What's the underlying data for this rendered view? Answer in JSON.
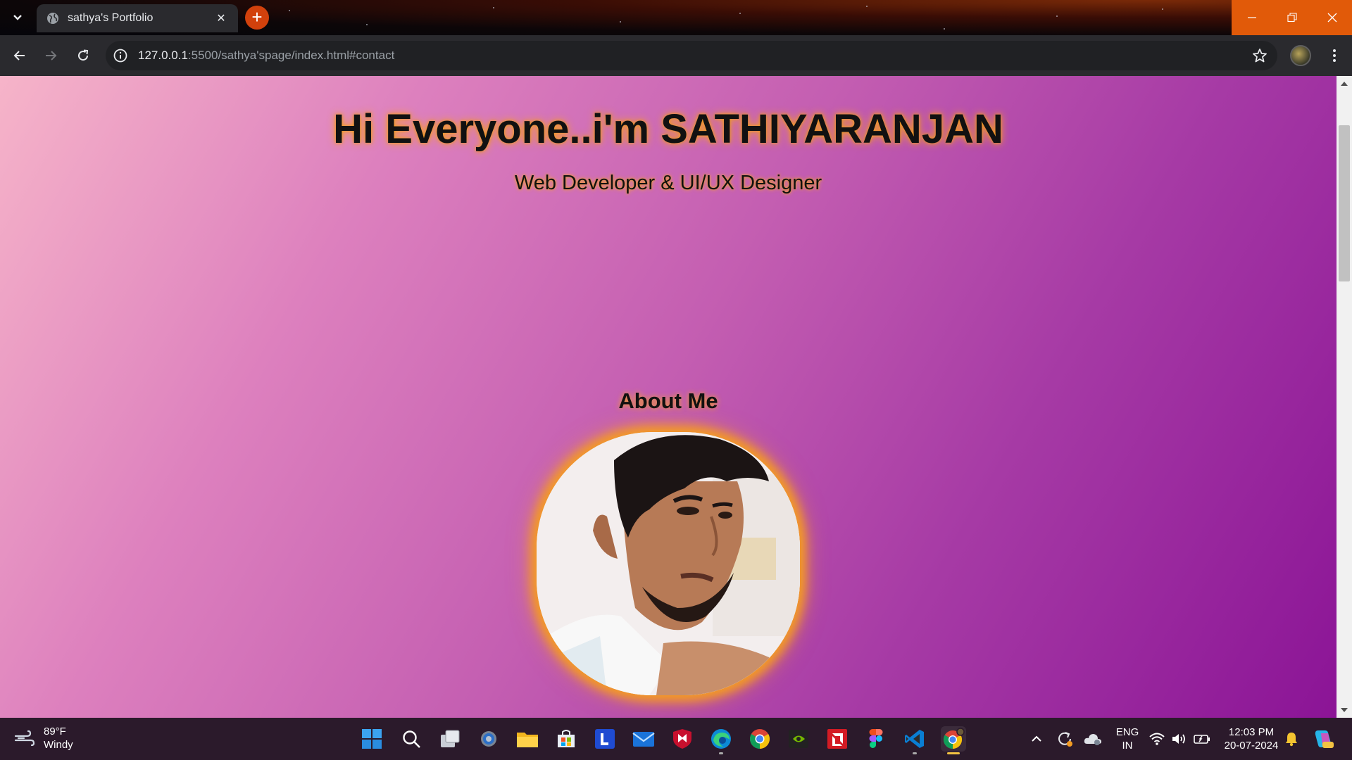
{
  "browser": {
    "tab_title": "sathya's Portfolio",
    "url_host": "127.0.0.1",
    "url_path": ":5500/sathya'spage/index.html#contact"
  },
  "page": {
    "hero_title": "Hi Everyone..i'm SATHIYARANJAN",
    "hero_subtitle": "Web Developer & UI/UX Designer",
    "about_heading": "About Me"
  },
  "taskbar": {
    "weather_temp": "89°F",
    "weather_desc": "Windy",
    "lang_line1": "ENG",
    "lang_line2": "IN",
    "time": "12:03 PM",
    "date": "20-07-2024",
    "apps": [
      "start-icon",
      "search-icon",
      "task-view-icon",
      "settings-icon",
      "file-explorer-icon",
      "store-icon",
      "l-app-icon",
      "mail-icon",
      "mcafee-icon",
      "edge-icon",
      "chrome-icon",
      "nvidia-icon",
      "amd-icon",
      "figma-icon",
      "vscode-icon",
      "chrome-profile-icon"
    ]
  },
  "colors": {
    "tab_accent": "#d2410c",
    "window_controls": "#e15a09",
    "glow": "#f49a24"
  }
}
